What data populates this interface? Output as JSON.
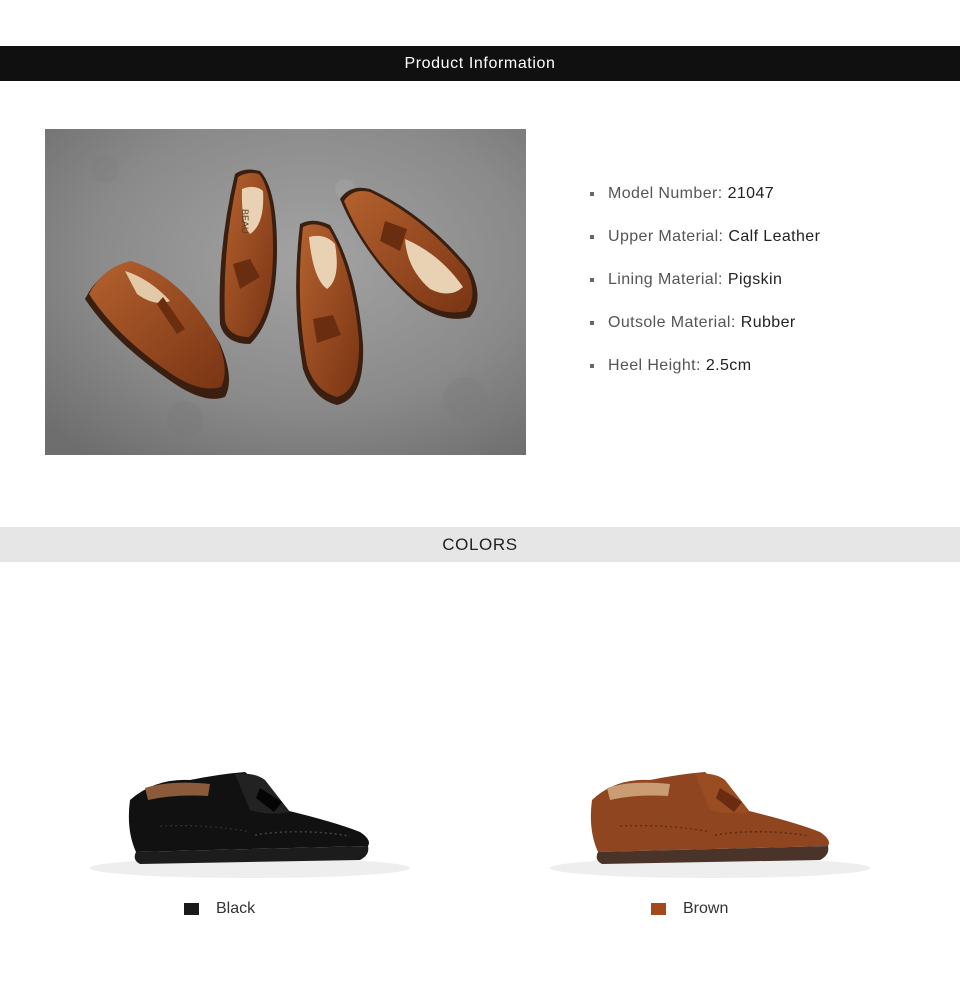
{
  "header": {
    "title": "Product Information"
  },
  "hero": {
    "brand_mark": "BEAU"
  },
  "specs": [
    {
      "label": "Model Number:",
      "value": "21047"
    },
    {
      "label": "Upper Material:",
      "value": "Calf Leather"
    },
    {
      "label": "Lining Material:",
      "value": "Pigskin"
    },
    {
      "label": "Outsole Material:",
      "value": "Rubber"
    },
    {
      "label": "Heel Height:",
      "value": "2.5cm"
    }
  ],
  "colors_section": {
    "title": "COLORS"
  },
  "colors": [
    {
      "name": "Black",
      "hex": "#1a1a1a"
    },
    {
      "name": "Brown",
      "hex": "#a24a1c"
    }
  ]
}
